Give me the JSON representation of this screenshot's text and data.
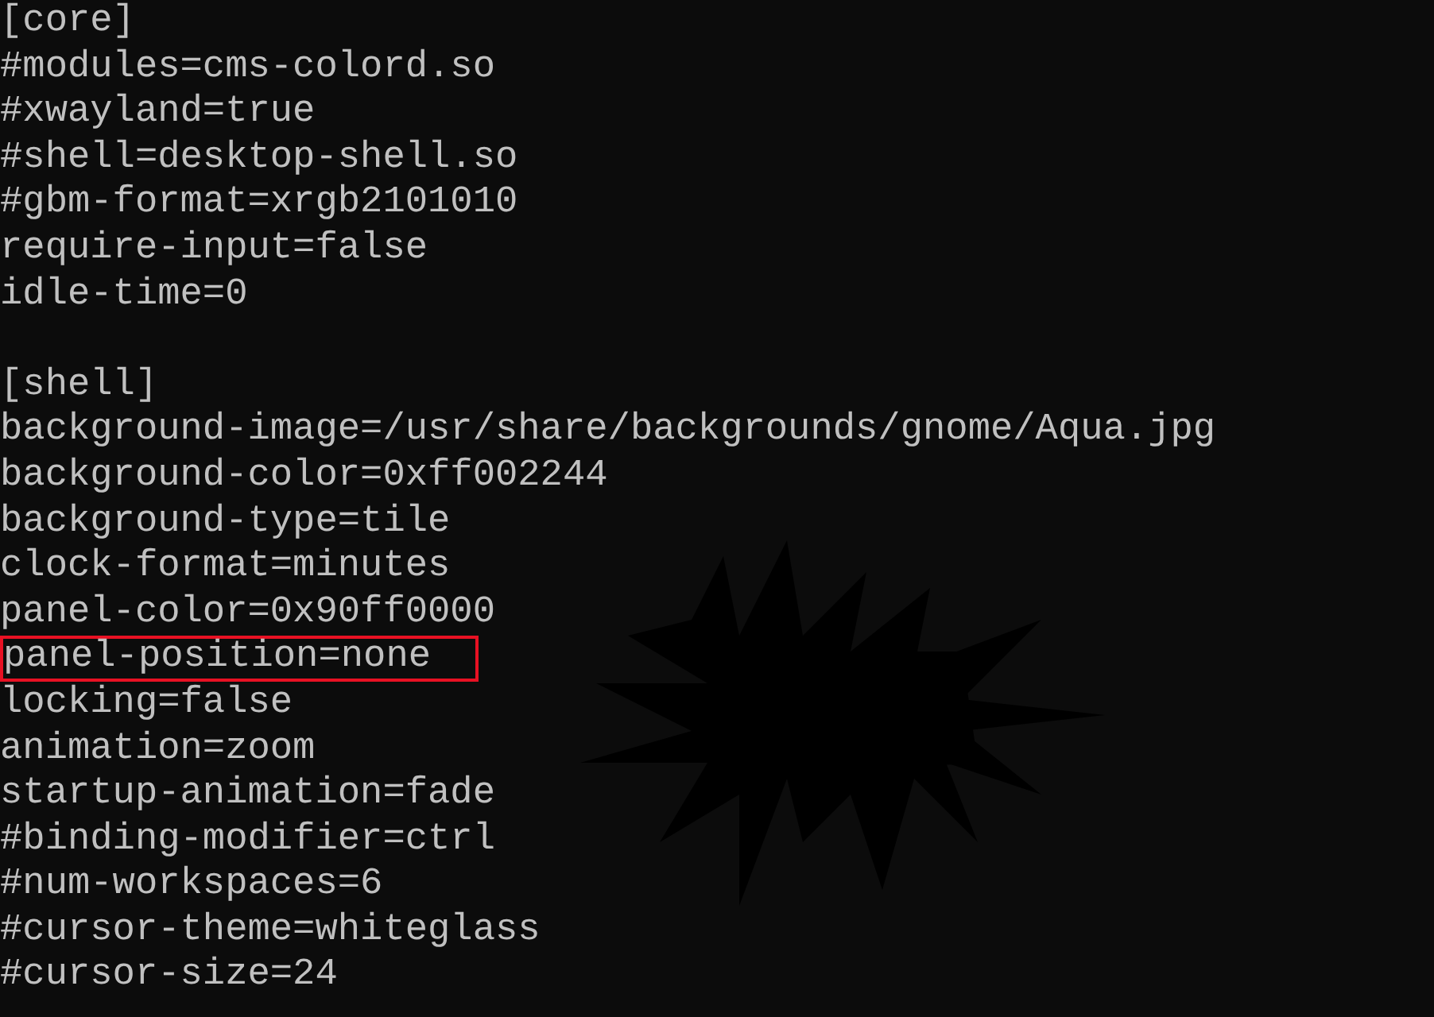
{
  "sections": [
    {
      "header": "[core]",
      "lines": [
        {
          "text": "#modules=cms-colord.so",
          "highlighted": false
        },
        {
          "text": "#xwayland=true",
          "highlighted": false
        },
        {
          "text": "#shell=desktop-shell.so",
          "highlighted": false
        },
        {
          "text": "#gbm-format=xrgb2101010",
          "highlighted": false
        },
        {
          "text": "require-input=false",
          "highlighted": false
        },
        {
          "text": "idle-time=0",
          "highlighted": false
        }
      ]
    },
    {
      "header": "[shell]",
      "lines": [
        {
          "text": "background-image=/usr/share/backgrounds/gnome/Aqua.jpg",
          "highlighted": false
        },
        {
          "text": "background-color=0xff002244",
          "highlighted": false
        },
        {
          "text": "background-type=tile",
          "highlighted": false
        },
        {
          "text": "clock-format=minutes",
          "highlighted": false
        },
        {
          "text": "panel-color=0x90ff0000",
          "highlighted": false
        },
        {
          "text": "panel-position=none",
          "highlighted": true
        },
        {
          "text": "locking=false",
          "highlighted": false
        },
        {
          "text": "animation=zoom",
          "highlighted": false
        },
        {
          "text": "startup-animation=fade",
          "highlighted": false
        },
        {
          "text": "#binding-modifier=ctrl",
          "highlighted": false
        },
        {
          "text": "#num-workspaces=6",
          "highlighted": false
        },
        {
          "text": "#cursor-theme=whiteglass",
          "highlighted": false
        },
        {
          "text": "#cursor-size=24",
          "highlighted": false
        }
      ]
    }
  ]
}
